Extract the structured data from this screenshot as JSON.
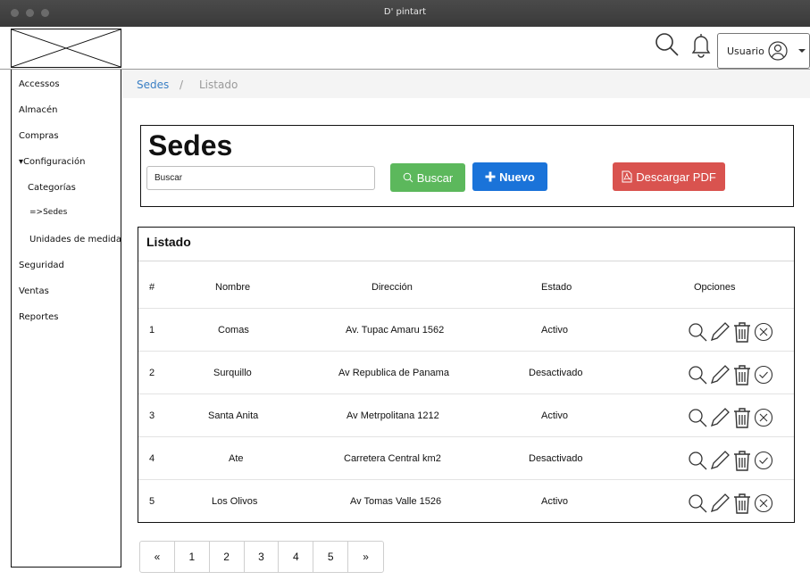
{
  "window": {
    "title": "D' pintart"
  },
  "header": {
    "user_label": "Usuario"
  },
  "sidebar": {
    "items": [
      {
        "label": "Accessos"
      },
      {
        "label": "Almacén"
      },
      {
        "label": "Compras"
      },
      {
        "label": "▾Configuración"
      },
      {
        "label": "Categorías"
      },
      {
        "label": "=>Sedes"
      },
      {
        "label": "Unidades de medida"
      },
      {
        "label": "Seguridad"
      },
      {
        "label": "Ventas"
      },
      {
        "label": "Reportes"
      }
    ]
  },
  "breadcrumb": {
    "first": "Sedes",
    "separator": "/",
    "current": "Listado"
  },
  "search": {
    "title": "Sedes",
    "input_value": "Buscar",
    "search_button": "Buscar",
    "new_button": "Nuevo",
    "pdf_button": "Descargar PDF"
  },
  "list": {
    "title": "Listado",
    "columns": [
      "#",
      "Nombre",
      "Dirección",
      "Estado",
      "Opciones"
    ],
    "rows": [
      {
        "id": "1",
        "nombre": "Comas",
        "direccion": "Av. Tupac Amaru 1562",
        "estado": "Activo"
      },
      {
        "id": "2",
        "nombre": "Surquillo",
        "direccion": "Av Republica de Panama",
        "estado": "Desactivado"
      },
      {
        "id": "3",
        "nombre": "Santa Anita",
        "direccion": "Av Metrpolitana 1212",
        "estado": "Activo"
      },
      {
        "id": "4",
        "nombre": "Ate",
        "direccion": "Carretera Central km2",
        "estado": "Desactivado"
      },
      {
        "id": "5",
        "nombre": "Los Olivos",
        "direccion": "Av Tomas Valle 1526",
        "estado": "Activo"
      }
    ]
  },
  "pagination": {
    "prev": "«",
    "pages": [
      "1",
      "2",
      "3",
      "4",
      "5"
    ],
    "next": "»"
  },
  "colors": {
    "accent_blue": "#1a73d9",
    "success_green": "#5cb85c",
    "danger_red": "#d9534f",
    "link_blue": "#3a7fc4"
  }
}
